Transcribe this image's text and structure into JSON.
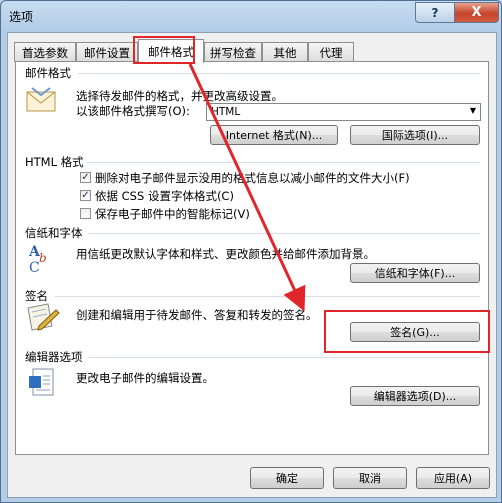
{
  "window": {
    "title": "选项",
    "help": "?",
    "close": "X"
  },
  "tabs": [
    {
      "label": "首选参数"
    },
    {
      "label": "邮件设置"
    },
    {
      "label": "邮件格式"
    },
    {
      "label": "拼写检查"
    },
    {
      "label": "其他"
    },
    {
      "label": "代理"
    }
  ],
  "mail_format": {
    "header": "邮件格式",
    "desc": "选择待发邮件的格式，并更改高级设置。",
    "compose_label": "以该邮件格式撰写(O):",
    "compose_value": "HTML",
    "internet_btn": "Internet 格式(N)...",
    "intl_btn": "国际选项(I)..."
  },
  "html_format": {
    "header": "HTML 格式",
    "options": [
      {
        "label": "删除对电子邮件显示没用的格式信息以减小邮件的文件大小(F)",
        "checked": true
      },
      {
        "label": "依据 CSS 设置字体格式(C)",
        "checked": true
      },
      {
        "label": "保存电子邮件中的智能标记(V)",
        "checked": false
      }
    ]
  },
  "stationery": {
    "header": "信纸和字体",
    "desc": "用信纸更改默认字体和样式、更改颜色并给邮件添加背景。",
    "button": "信纸和字体(F)..."
  },
  "signature": {
    "header": "签名",
    "desc": "创建和编辑用于待发邮件、答复和转发的签名。",
    "button": "签名(G)..."
  },
  "editor": {
    "header": "编辑器选项",
    "desc": "更改电子邮件的编辑设置。",
    "button": "编辑器选项(D)..."
  },
  "footer": {
    "ok": "确定",
    "cancel": "取消",
    "apply": "应用(A)"
  },
  "colors": {
    "highlight": "#e0262b",
    "title_bg": "#b3cde6",
    "panel_bg": "#ffffff"
  }
}
